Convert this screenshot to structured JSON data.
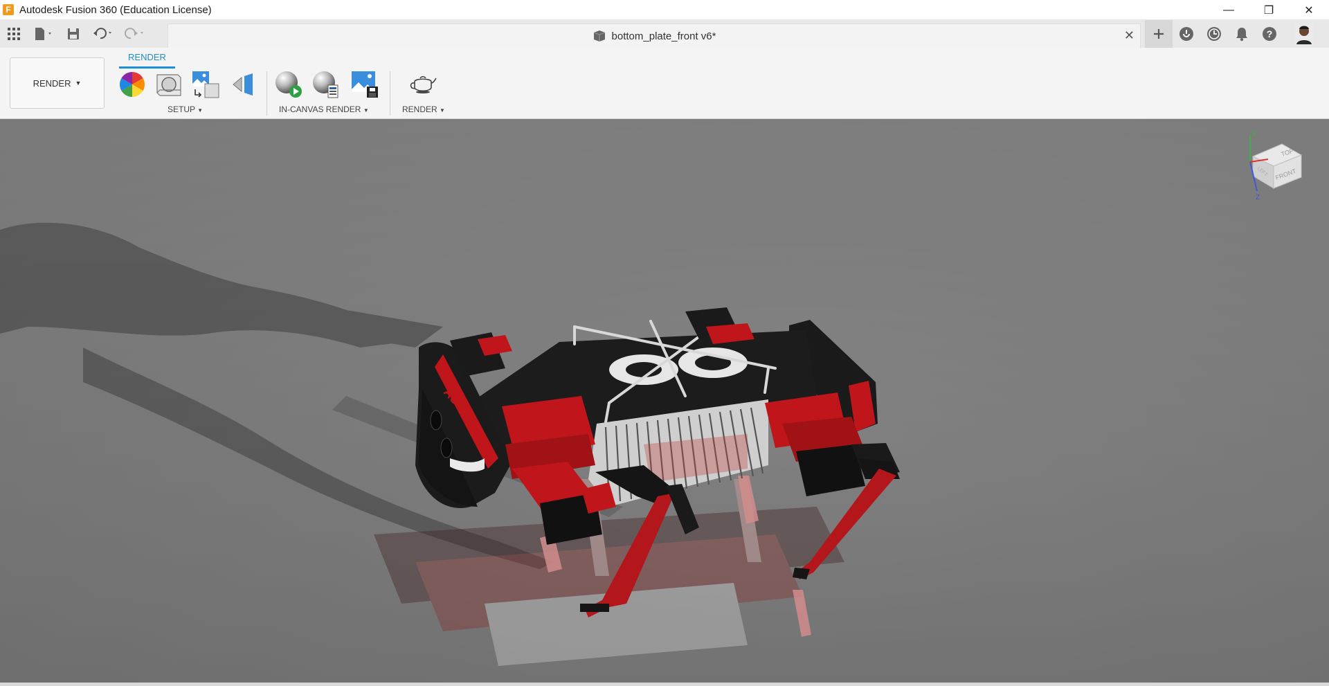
{
  "window": {
    "title": "Autodesk Fusion 360 (Education License)",
    "logo_letter": "F",
    "controls": {
      "minimize": "—",
      "restore": "❐",
      "close": "✕"
    }
  },
  "qat": {
    "document_title": "bottom_plate_front v6*",
    "tab_close": "✕"
  },
  "ribbon": {
    "workspace_label": "RENDER",
    "active_tab": "RENDER",
    "groups": {
      "setup": "SETUP",
      "in_canvas_render": "IN-CANVAS RENDER",
      "render": "RENDER"
    }
  },
  "viewcube": {
    "top": "TOP",
    "front": "FRONT",
    "left": "LEFT",
    "axis_y": "Y",
    "axis_z": "Z"
  },
  "model": {
    "side_text": "ASC"
  },
  "colors": {
    "accent": "#1d8fd6",
    "robot_red": "#b3161b",
    "robot_black": "#1a1a1a",
    "canvas": "#7a7a7a"
  }
}
